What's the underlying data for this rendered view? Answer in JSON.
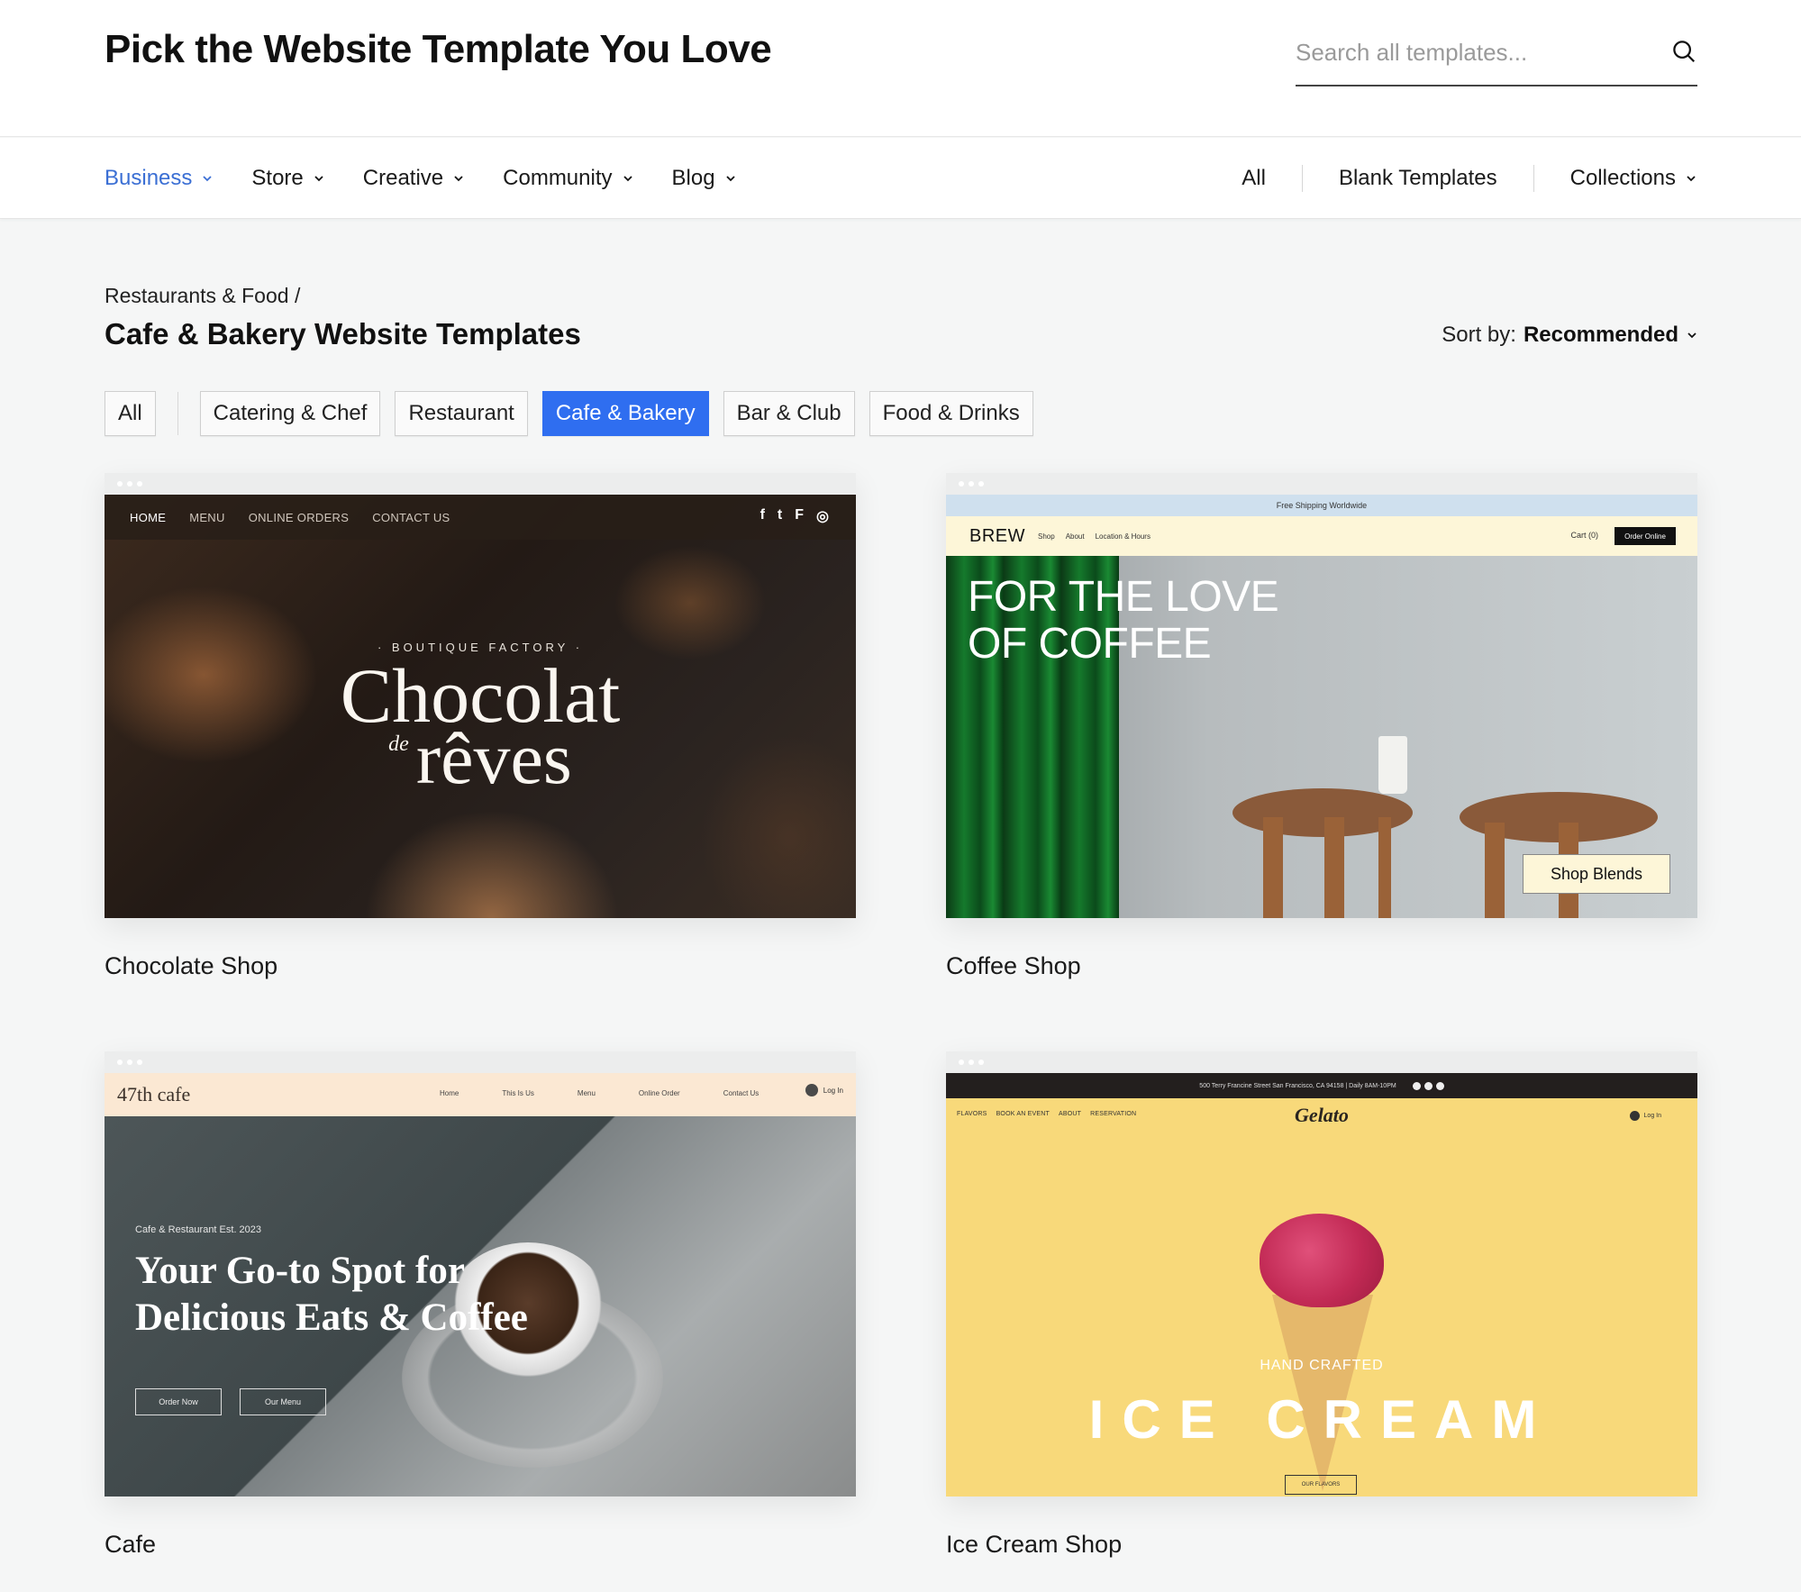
{
  "header": {
    "title": "Pick the Website Template You Love",
    "search_placeholder": "Search all templates...",
    "search_value": "",
    "search_icon": "search-icon"
  },
  "nav": {
    "categories": [
      {
        "label": "Business",
        "active": true
      },
      {
        "label": "Store",
        "active": false
      },
      {
        "label": "Creative",
        "active": false
      },
      {
        "label": "Community",
        "active": false
      },
      {
        "label": "Blog",
        "active": false
      }
    ],
    "right": {
      "all": "All",
      "blank": "Blank Templates",
      "collections": "Collections"
    },
    "active_color": "#3b6fd4"
  },
  "section": {
    "breadcrumb": "Restaurants & Food /",
    "title": "Cafe & Bakery Website Templates",
    "sort_label": "Sort by:",
    "sort_value": "Recommended"
  },
  "filters": {
    "items": [
      "All",
      "Catering & Chef",
      "Restaurant",
      "Cafe & Bakery",
      "Bar & Club",
      "Food & Drinks"
    ],
    "active": "Cafe & Bakery",
    "active_color": "#2f6ef0"
  },
  "templates": [
    {
      "name": "Chocolate Shop",
      "preview": {
        "nav": [
          "HOME",
          "MENU",
          "ONLINE ORDERS",
          "CONTACT US"
        ],
        "social": [
          "facebook-icon",
          "twitter-icon",
          "foursquare-icon",
          "instagram-icon"
        ],
        "eyebrow": "· BOUTIQUE FACTORY ·",
        "title_line1": "Chocolat",
        "title_small": "de",
        "title_line2": "rêves"
      }
    },
    {
      "name": "Coffee Shop",
      "preview": {
        "promo": "Free Shipping Worldwide",
        "brand": "BREW",
        "nav": [
          "Shop",
          "About",
          "Location & Hours"
        ],
        "cart": "Cart (0)",
        "order": "Order Online",
        "title_line1": "FOR THE LOVE",
        "title_line2": "OF COFFEE",
        "cta": "Shop Blends"
      }
    },
    {
      "name": "Cafe",
      "preview": {
        "logo": "47th cafe",
        "nav": [
          "Home",
          "This Is Us",
          "Menu",
          "Online Order",
          "Contact Us"
        ],
        "login": "Log In",
        "eyebrow": "Cafe & Restaurant Est. 2023",
        "title_line1": "Your Go-to Spot for",
        "title_line2": "Delicious Eats & Coffee",
        "buttons": [
          "Order Now",
          "Our Menu"
        ]
      }
    },
    {
      "name": "Ice Cream Shop",
      "preview": {
        "topbar": "500 Terry Francine Street San Francisco, CA 94158  |  Daily 8AM-10PM",
        "nav": [
          "FLAVORS",
          "BOOK AN EVENT",
          "ABOUT",
          "RESERVATION"
        ],
        "logo": "Gelato",
        "login": "Log In",
        "eyebrow": "HAND CRAFTED",
        "title": "ICE CREAM",
        "cta": "OUR FLAVORS"
      }
    }
  ]
}
